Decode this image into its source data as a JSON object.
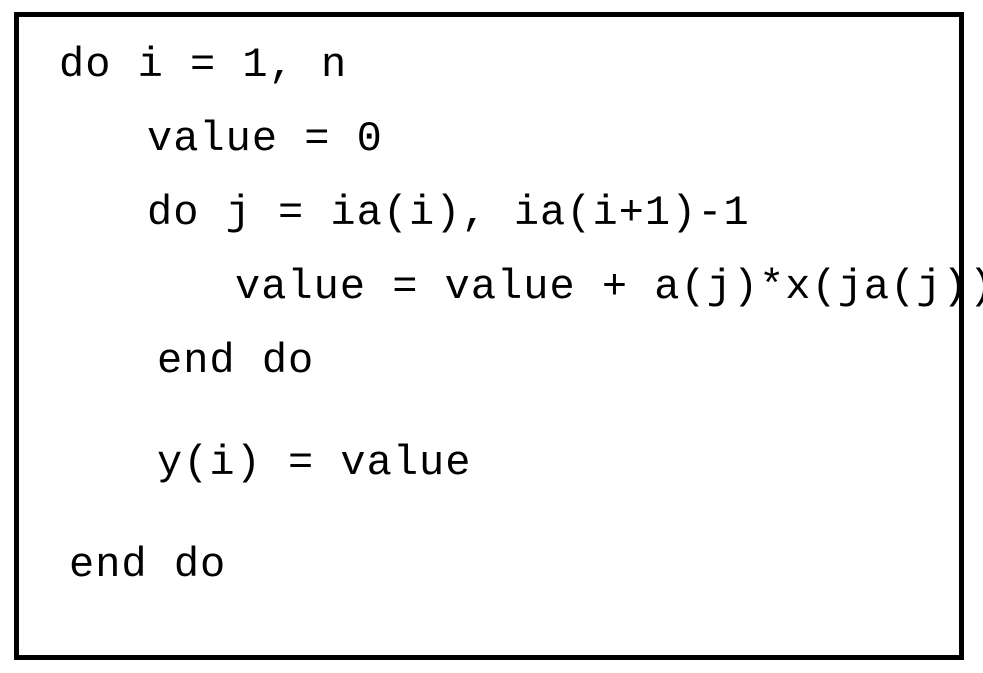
{
  "code": {
    "line1": "do i = 1, n",
    "line2": "value = 0",
    "line3": "do j = ia(i), ia(i+1)-1",
    "line4": "value = value + a(j)*x(ja(j))",
    "line5": "end do",
    "line6": "y(i) = value",
    "line7": "end do"
  }
}
